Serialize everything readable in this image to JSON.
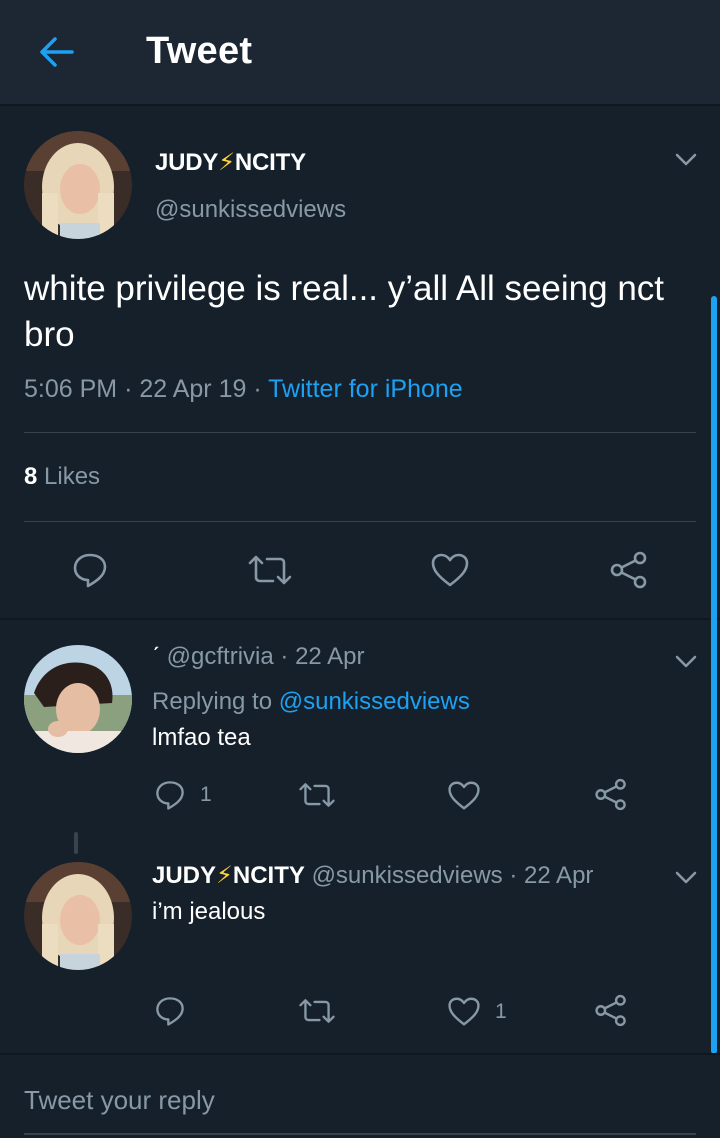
{
  "header": {
    "title": "Tweet"
  },
  "main_tweet": {
    "name_prefix": "JUDY",
    "name_emoji": "⚡",
    "name_suffix": "NCITY",
    "handle": "@sunkissedviews",
    "text": "white privilege is real... y’all All seeing nct bro",
    "time": "5:06 PM",
    "date": "22 Apr 19",
    "source": "Twitter for iPhone",
    "likes_count": "8",
    "likes_label": "Likes"
  },
  "replies": [
    {
      "name_prefix": "ˊ",
      "handle": "@gcftrivia",
      "date": "22 Apr",
      "replying_to_label": "Replying to",
      "replying_to_handle": "@sunkissedviews",
      "text": "lmfao tea",
      "reply_count": "1",
      "like_count": ""
    },
    {
      "name_prefix": "JUDY",
      "name_emoji": "⚡",
      "name_suffix": "NCITY",
      "handle": "@sunkissedviews",
      "date": "22 Apr",
      "text": "i’m jealous",
      "reply_count": "",
      "like_count": "1"
    }
  ],
  "compose": {
    "placeholder": "Tweet your reply"
  },
  "separator": "·",
  "colors": {
    "background": "#15202b",
    "header": "#1c2733",
    "accent": "#1da1f2",
    "secondary_text": "#8899a6",
    "divider": "#38444d"
  },
  "icons": {
    "back": "arrow-left-icon",
    "reply": "speech-bubble-icon",
    "retweet": "retweet-icon",
    "like": "heart-icon",
    "share": "share-icon",
    "menu": "chevron-down-icon"
  }
}
